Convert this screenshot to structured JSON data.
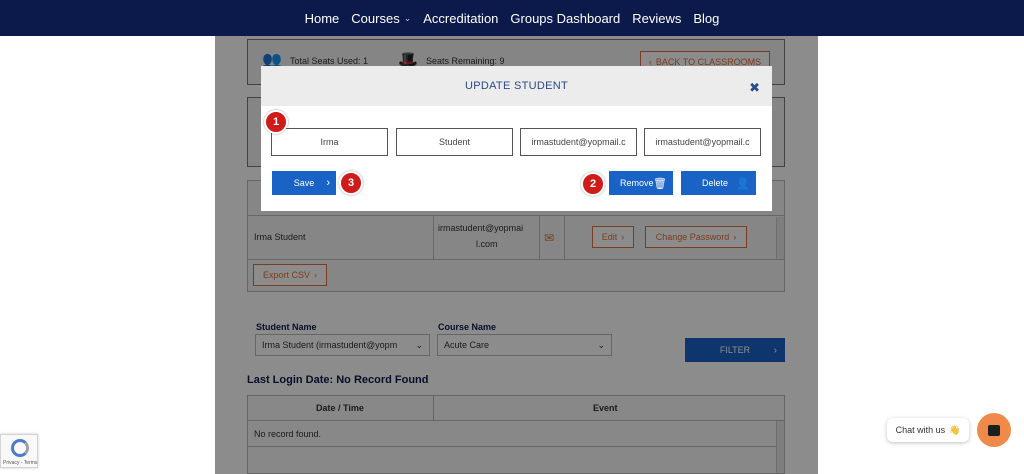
{
  "nav": {
    "items": [
      "Home",
      "Courses",
      "Accreditation",
      "Groups Dashboard",
      "Reviews",
      "Blog"
    ]
  },
  "seats": {
    "used_label": "Total Seats Used: 1",
    "remaining_label": "Seats Remaining: 9",
    "back_button": "BACK TO CLASSROOMS"
  },
  "student_table": {
    "name": "Irma Student",
    "email_line1": "irmastudent@yopmai",
    "email_line2": "l.com",
    "edit_label": "Edit",
    "change_password_label": "Change Password",
    "export_label": "Export CSV"
  },
  "filter": {
    "student_label": "Student Name",
    "student_value": "Irma Student (irmastudent@yopm",
    "course_label": "Course Name",
    "course_value": "Acute Care",
    "button_label": "FILTER"
  },
  "login": {
    "title": "Last Login Date: No Record Found",
    "col_date": "Date / Time",
    "col_event": "Event",
    "empty": "No record found."
  },
  "modal": {
    "title": "UPDATE STUDENT",
    "close": "✖",
    "first_name": "Irma",
    "last_name": "Student",
    "email": "irmastudent@yopmail.c",
    "username": "irmastudent@yopmail.c",
    "save_label": "Save",
    "remove_label": "Remove",
    "delete_label": "Delete"
  },
  "markers": [
    "1",
    "2",
    "3"
  ],
  "chat": {
    "label": "Chat with us",
    "emoji": "👋"
  },
  "recaptcha": {
    "text": "Privacy - Terms"
  },
  "colors": {
    "nav_bg": "#0b1a4a",
    "primary": "#1a63c6",
    "accent_orange": "#e0703a",
    "marker_red": "#d01b1b",
    "chat_orange": "#f08a4b"
  }
}
